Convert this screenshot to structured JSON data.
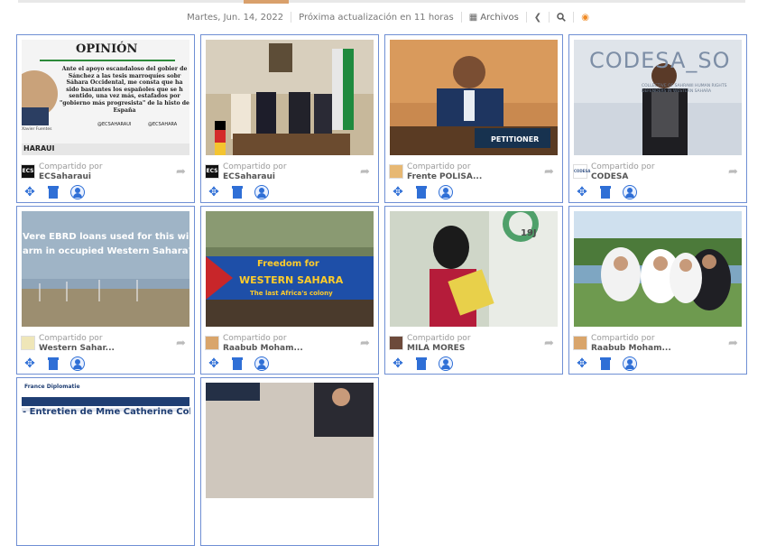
{
  "header": {
    "date": "Martes, Jun. 14, 2022",
    "next_update": "Próxima actualización en 11 horas",
    "archives": "Archivos"
  },
  "shared_by_label": "Compartido por",
  "cards": [
    {
      "user": "ECSaharaui",
      "thumb_title": "OPINIÓN",
      "thumb_text": "Ante el apoyo escandaloso del gobier de Sánchez a las tesis marroquíes sobr Sáhara Occidental, me consta que ha sido bastantes los españoles que se h sentido, una vez más, estafados por \"gobierno más progresista\" de la histo de España",
      "thumb_handle1": "@ECSAHARAUI",
      "thumb_handle2": "@ECSAHARA",
      "thumb_footer": "HARAUI",
      "thumb_author": "Xavier Fuentes"
    },
    {
      "user": "ECSaharaui"
    },
    {
      "user": "Frente POLISA...",
      "thumb_sign": "PETITIONER"
    },
    {
      "user": "CODESA",
      "thumb_title": "CODESA_SO",
      "thumb_sub": "COLLECTIVE OF SAHRAWI HUMAN RIGHTS DEFENDERS IN WESTERN SAHARA"
    },
    {
      "user": "Western Sahar...",
      "thumb_text1": "Vere EBRD loans used for this wind",
      "thumb_text2": "arm in occupied Western Sahara?"
    },
    {
      "user": "Raabub Moham...",
      "thumb_banner1": "Freedom for",
      "thumb_banner2": "WESTERN SAHARA",
      "thumb_banner3": "The last Africa's colony"
    },
    {
      "user": "MILA MORES",
      "thumb_text": "19J"
    },
    {
      "user": "Raabub Moham..."
    },
    {
      "user": "",
      "thumb_title": "France Diplomatie",
      "thumb_text": "- Entretien de Mme Catherine Colo"
    },
    {
      "user": ""
    }
  ]
}
